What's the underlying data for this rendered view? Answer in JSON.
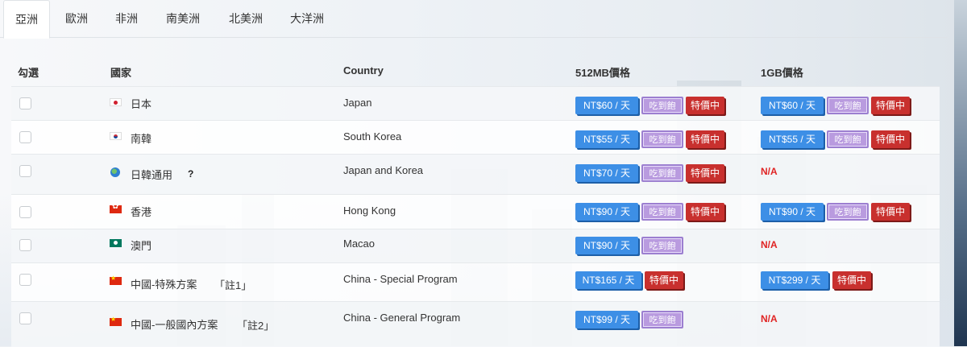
{
  "tabs": [
    "亞洲",
    "歐洲",
    "非洲",
    "南美洲",
    "北美洲",
    "大洋洲"
  ],
  "headers": {
    "select": "勾選",
    "country_zh": "國家",
    "country_en": "Country",
    "price_512": "512MB價格",
    "price_1g": "1GB價格"
  },
  "labels": {
    "eat_all": "吃到飽",
    "on_sale": "特價中",
    "na": "N/A",
    "help": "?"
  },
  "rows": [
    {
      "flag": "japan-flag",
      "zh": "日本",
      "note": "",
      "en": "Japan",
      "p512": "NT$60 / 天",
      "p1g": "NT$60 / 天"
    },
    {
      "flag": "korea-flag",
      "zh": "南韓",
      "note": "",
      "en": "South Korea",
      "p512": "NT$55 / 天",
      "p1g": "NT$55 / 天"
    },
    {
      "flag": "globe-icon",
      "zh": "日韓通用",
      "note": "",
      "en": "Japan and Korea",
      "p512": "NT$70 / 天",
      "p1g": "N/A"
    },
    {
      "flag": "hong-kong-flag",
      "zh": "香港",
      "note": "",
      "en": "Hong Kong",
      "p512": "NT$90 / 天",
      "p1g": "NT$90 / 天"
    },
    {
      "flag": "macao-flag",
      "zh": "澳門",
      "note": "",
      "en": "Macao",
      "p512": "NT$90 / 天",
      "p1g": "N/A"
    },
    {
      "flag": "china-flag",
      "zh": "中國-特殊方案",
      "note": "「註1」",
      "en": "China - Special Program",
      "p512": "NT$165 / 天",
      "p1g": "NT$299 / 天"
    },
    {
      "flag": "china-flag",
      "zh": "中國-一般國內方案",
      "note": "「註2」",
      "en": "China - General Program",
      "p512": "NT$99 / 天",
      "p1g": "N/A"
    }
  ]
}
